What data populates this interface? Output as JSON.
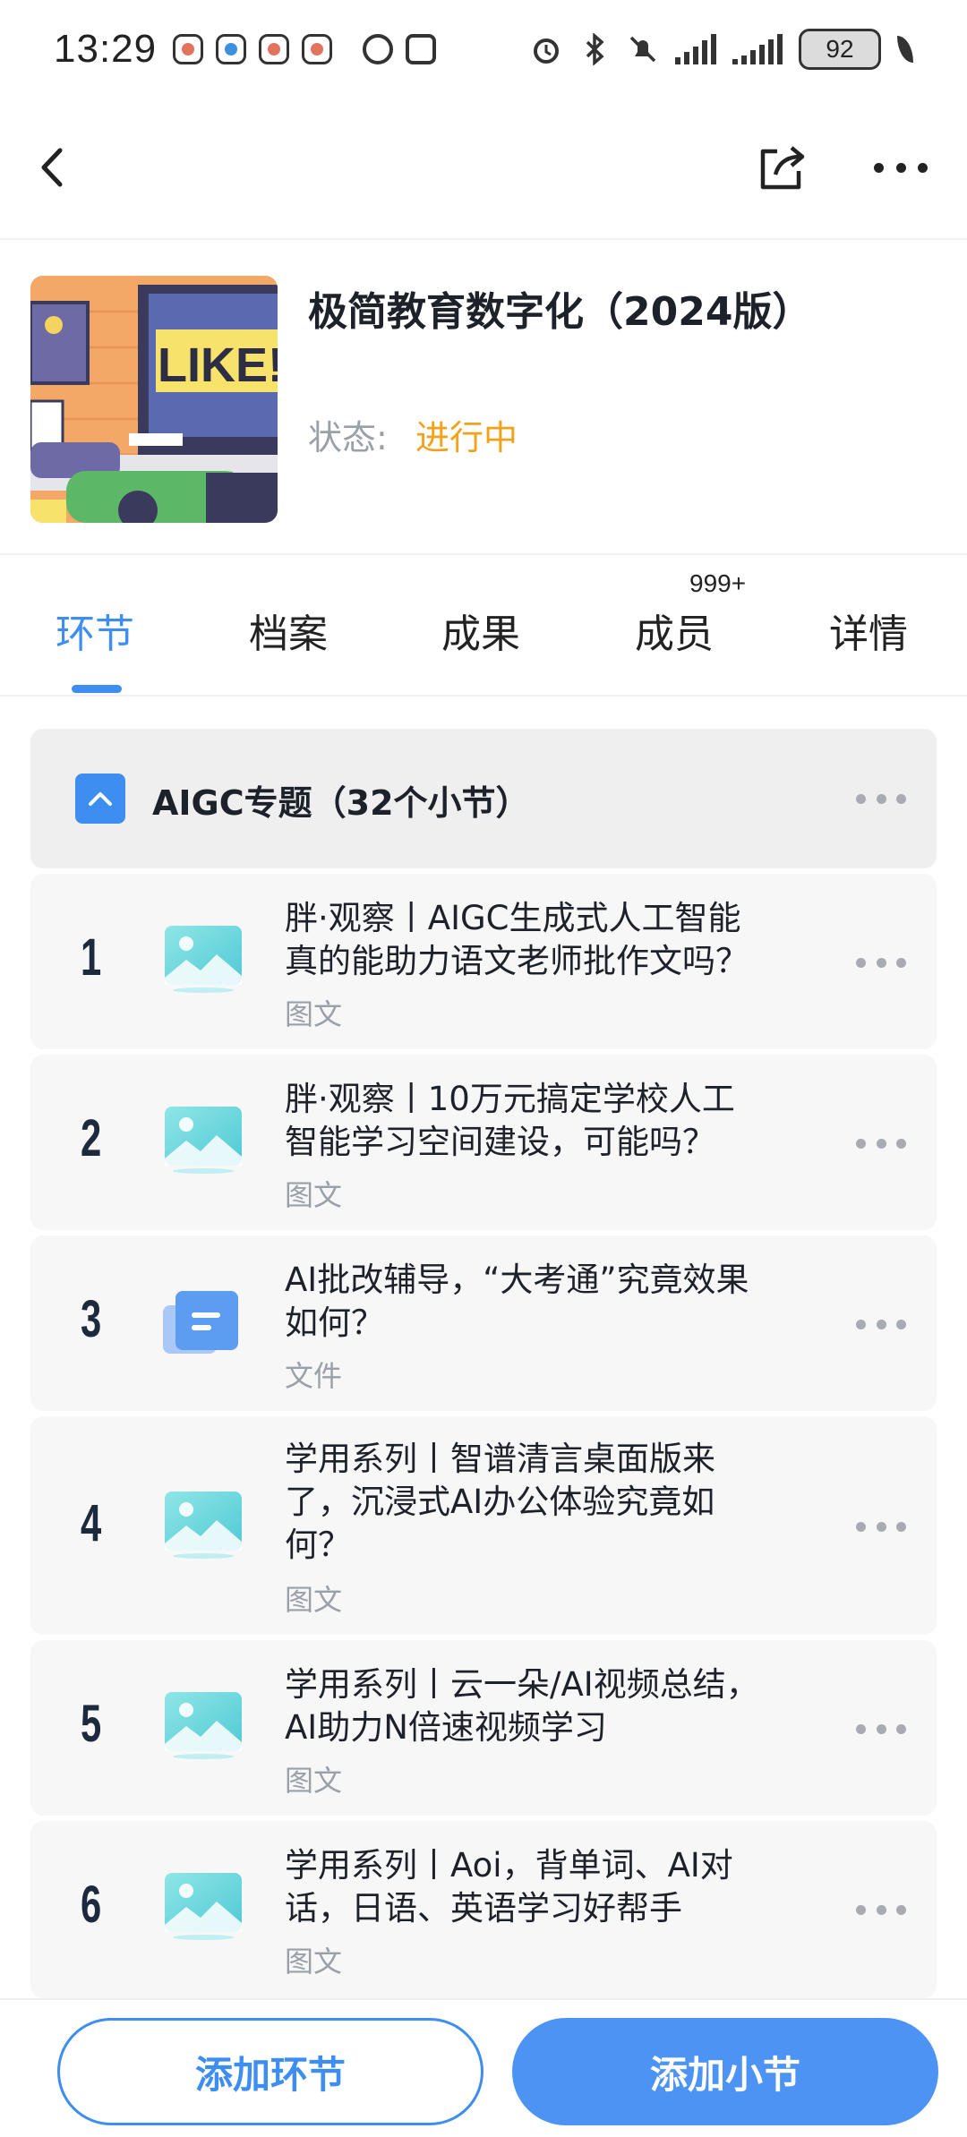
{
  "status_bar": {
    "time": "13:29",
    "battery": "92"
  },
  "course": {
    "title": "极简教育数字化（2024版）",
    "status_label": "状态:",
    "status_value": "进行中",
    "cover_text": "LIKE!"
  },
  "tabs": [
    {
      "label": "环节",
      "active": true
    },
    {
      "label": "档案"
    },
    {
      "label": "成果"
    },
    {
      "label": "成员",
      "badge": "999+"
    },
    {
      "label": "详情"
    }
  ],
  "section": {
    "title": "AIGC专题（32个小节）"
  },
  "items": [
    {
      "num": "1",
      "title_line1": "胖·观察丨AIGC生成式人工智能",
      "title_line2": "真的能助力语文老师批作文吗？",
      "type": "图文",
      "icon": "image-icon"
    },
    {
      "num": "2",
      "title_line1": "胖·观察丨10万元搞定学校人工",
      "title_line2": "智能学习空间建设，可能吗？",
      "type": "图文",
      "icon": "image-icon"
    },
    {
      "num": "3",
      "title_line1": "AI批改辅导，“大考通”究竟效果",
      "title_line2": "如何？",
      "type": "文件",
      "icon": "file-icon"
    },
    {
      "num": "4",
      "title_line1": "学用系列丨智谱清言桌面版来",
      "title_line2": "了，沉浸式AI办公体验究竟如",
      "title_line3": "何？",
      "type": "图文",
      "icon": "image-icon"
    },
    {
      "num": "5",
      "title_line1": "学用系列丨云一朵/AI视频总结，",
      "title_line2": "AI助力N倍速视频学习",
      "type": "图文",
      "icon": "image-icon"
    },
    {
      "num": "6",
      "title_line1": "学用系列丨Aoi，背单词、AI对",
      "title_line2": "话，日语、英语学习好帮手",
      "type": "图文",
      "icon": "image-icon"
    }
  ],
  "actions": {
    "add_segment": "添加环节",
    "add_section": "添加小节"
  },
  "colors": {
    "accent": "#3d8ef0",
    "status_in_progress": "#f0a21b"
  }
}
